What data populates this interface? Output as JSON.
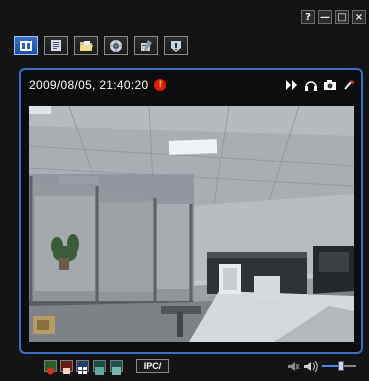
{
  "window": {
    "controls": [
      "?",
      "—",
      "□",
      "×"
    ]
  },
  "toolbar": {
    "buttons": [
      {
        "icon": "live-view-icon",
        "active": true
      },
      {
        "icon": "record-list-icon",
        "active": false
      },
      {
        "icon": "folder-open-icon",
        "active": false
      },
      {
        "icon": "network-settings-icon",
        "active": false
      },
      {
        "icon": "tools-icon",
        "active": false
      },
      {
        "icon": "info-icon",
        "active": false
      }
    ]
  },
  "viewer": {
    "timestamp": "2009/08/05, 21:40:20",
    "alarm_glyph": "!",
    "alarm_color": "#e01a10",
    "border_color": "#3c6fc4",
    "right_icons": [
      "fast-forward-icon",
      "audio-icon",
      "snapshot-icon",
      "ptz-icon"
    ]
  },
  "footer": {
    "ipc_label": "IPC/",
    "view_buttons": [
      "record-icon",
      "stop-icon",
      "multi-view-icon",
      "fullscreen-icon",
      "window-icon"
    ],
    "volume_level": 0.55
  }
}
